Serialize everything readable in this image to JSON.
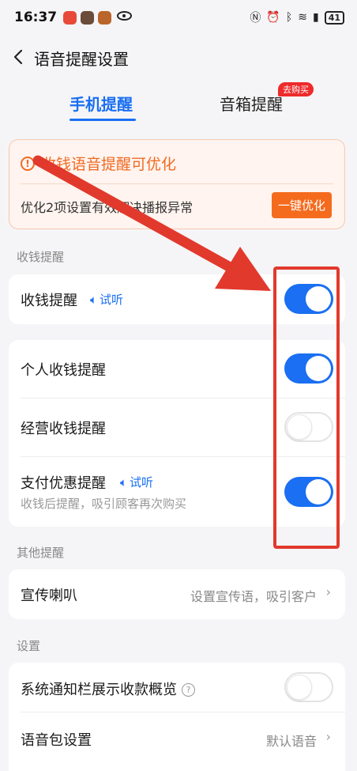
{
  "status_bar": {
    "time": "16:37",
    "battery": "41"
  },
  "nav": {
    "title": "语音提醒设置"
  },
  "tabs": {
    "phone": "手机提醒",
    "speaker": "音箱提醒",
    "buy_badge": "去购买"
  },
  "optimize": {
    "title": "收钱语音提醒可优化",
    "desc": "优化2项设置有效解决播报异常",
    "button": "一键优化"
  },
  "sections": {
    "collect": "收钱提醒",
    "other": "其他提醒",
    "settings": "设置"
  },
  "rows": {
    "collect_main": {
      "label": "收钱提醒",
      "listen": "试听",
      "enabled": true
    },
    "personal": {
      "label": "个人收钱提醒",
      "enabled": true
    },
    "business": {
      "label": "经营收钱提醒",
      "enabled": false
    },
    "discount": {
      "label": "支付优惠提醒",
      "listen": "试听",
      "sub": "收钱后提醒，吸引顾客再次购买",
      "enabled": true
    },
    "speaker_promo": {
      "label": "宣传喇叭",
      "value": "设置宣传语，吸引客户"
    },
    "notify_overview": {
      "label": "系统通知栏展示收款概览",
      "enabled": false
    },
    "voice_pack": {
      "label": "语音包设置",
      "value": "默认语音"
    }
  },
  "colors": {
    "accent": "#1a6ff2",
    "warning": "#f06a22",
    "annotation": "#e2392d"
  }
}
